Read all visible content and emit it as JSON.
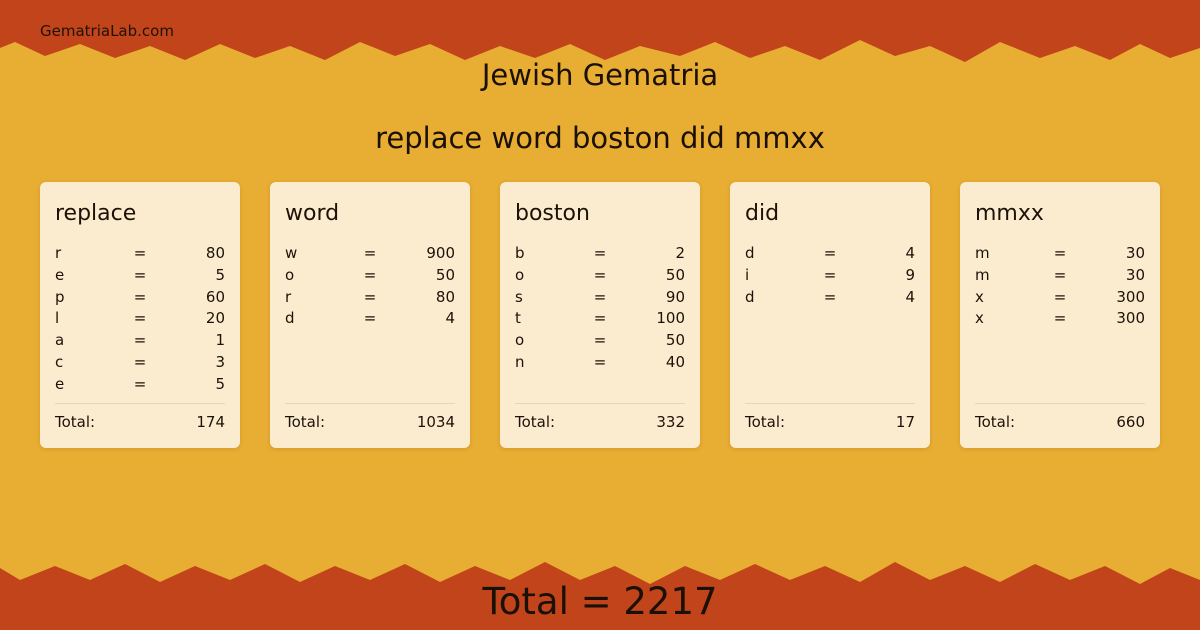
{
  "site": "GematriaLab.com",
  "title": "Jewish Gematria",
  "phrase": "replace word boston did mmxx",
  "colors": {
    "background": "#e8ad33",
    "border": "#c2441a",
    "card": "#fbecd0"
  },
  "total_label": "Total:",
  "equals": "=",
  "words": [
    {
      "word": "replace",
      "letters": [
        {
          "l": "r",
          "v": "80"
        },
        {
          "l": "e",
          "v": "5"
        },
        {
          "l": "p",
          "v": "60"
        },
        {
          "l": "l",
          "v": "20"
        },
        {
          "l": "a",
          "v": "1"
        },
        {
          "l": "c",
          "v": "3"
        },
        {
          "l": "e",
          "v": "5"
        }
      ],
      "total": "174"
    },
    {
      "word": "word",
      "letters": [
        {
          "l": "w",
          "v": "900"
        },
        {
          "l": "o",
          "v": "50"
        },
        {
          "l": "r",
          "v": "80"
        },
        {
          "l": "d",
          "v": "4"
        }
      ],
      "total": "1034"
    },
    {
      "word": "boston",
      "letters": [
        {
          "l": "b",
          "v": "2"
        },
        {
          "l": "o",
          "v": "50"
        },
        {
          "l": "s",
          "v": "90"
        },
        {
          "l": "t",
          "v": "100"
        },
        {
          "l": "o",
          "v": "50"
        },
        {
          "l": "n",
          "v": "40"
        }
      ],
      "total": "332"
    },
    {
      "word": "did",
      "letters": [
        {
          "l": "d",
          "v": "4"
        },
        {
          "l": "i",
          "v": "9"
        },
        {
          "l": "d",
          "v": "4"
        }
      ],
      "total": "17"
    },
    {
      "word": "mmxx",
      "letters": [
        {
          "l": "m",
          "v": "30"
        },
        {
          "l": "m",
          "v": "30"
        },
        {
          "l": "x",
          "v": "300"
        },
        {
          "l": "x",
          "v": "300"
        }
      ],
      "total": "660"
    }
  ],
  "grand_total": "Total = 2217"
}
